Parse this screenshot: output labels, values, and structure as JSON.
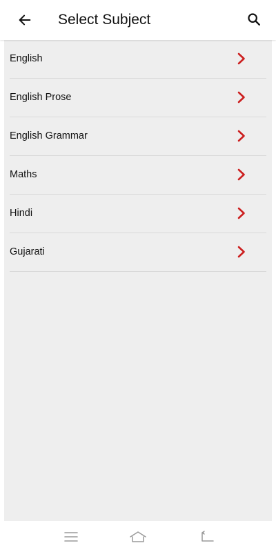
{
  "header": {
    "title": "Select Subject",
    "back_icon": "arrow-left-icon",
    "search_icon": "search-icon"
  },
  "subjects": [
    {
      "label": "English"
    },
    {
      "label": "English Prose"
    },
    {
      "label": "English Grammar"
    },
    {
      "label": "Maths"
    },
    {
      "label": "Hindi"
    },
    {
      "label": "Gujarati"
    }
  ],
  "chevron_icon": "chevron-right-icon",
  "navigation_bar": {
    "menu_icon": "menu-icon",
    "home_icon": "home-icon",
    "back_icon": "back-icon"
  },
  "colors": {
    "accent": "#cc1f1f",
    "list_background": "#eeeeee",
    "divider": "#d9d9d9",
    "text": "#111111",
    "nav_icon": "#9a9a9a"
  }
}
